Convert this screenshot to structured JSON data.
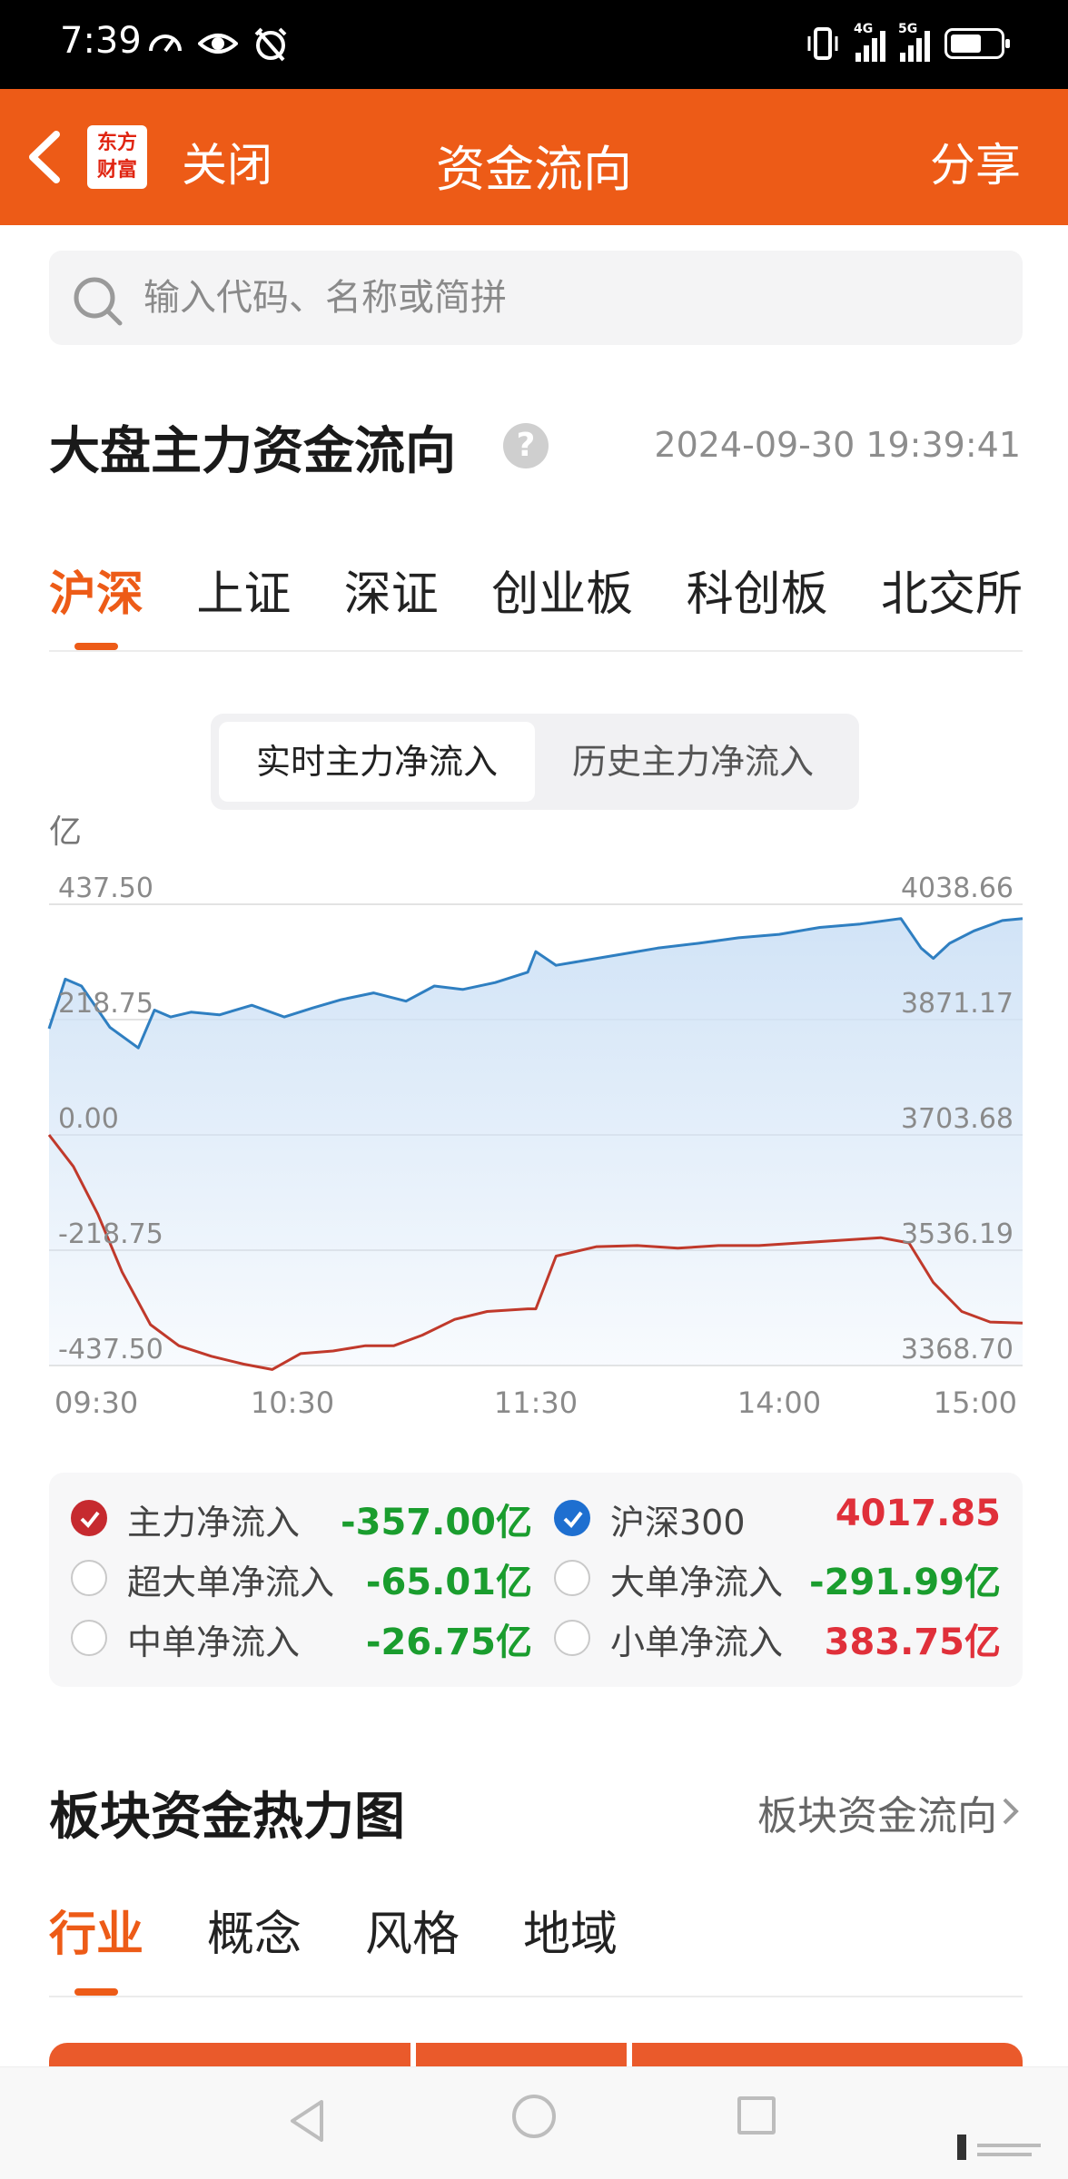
{
  "status_bar": {
    "time": "7:39",
    "net_4g": "4G",
    "net_5g": "5G"
  },
  "nav": {
    "back_icon": "chevron-left-icon",
    "logo_line1": "东方",
    "logo_line2": "财富",
    "close": "关闭",
    "title": "资金流向",
    "share": "分享"
  },
  "search": {
    "placeholder": "输入代码、名称或简拼",
    "value": ""
  },
  "section": {
    "title": "大盘主力资金流向",
    "help": "?",
    "timestamp": "2024-09-30 19:39:41"
  },
  "market_tabs": [
    {
      "label": "沪深",
      "active": true
    },
    {
      "label": "上证",
      "active": false
    },
    {
      "label": "深证",
      "active": false
    },
    {
      "label": "创业板",
      "active": false
    },
    {
      "label": "科创板",
      "active": false
    },
    {
      "label": "北交所",
      "active": false
    }
  ],
  "toggle": {
    "realtime": "实时主力净流入",
    "history": "历史主力净流入",
    "active": "realtime"
  },
  "chart_data": {
    "type": "line",
    "unit_label": "亿",
    "left_axis_ticks": [
      "437.50",
      "218.75",
      "0.00",
      "-218.75",
      "-437.50"
    ],
    "right_axis_ticks": [
      "4038.66",
      "3871.17",
      "3703.68",
      "3536.19",
      "3368.70"
    ],
    "x_ticks": [
      "09:30",
      "10:30",
      "11:30",
      "14:00",
      "15:00"
    ],
    "left_ylim": [
      -437.5,
      437.5
    ],
    "right_ylim": [
      3368.7,
      4038.66
    ],
    "grid": true,
    "colors": {
      "index": "#2f7fc1",
      "net_inflow": "#c0392b",
      "fill_top": "#cfe2f6"
    },
    "series": [
      {
        "name": "沪深300",
        "axis": "right",
        "color": "#2f7fc1",
        "x": [
          "09:30",
          "09:34",
          "09:38",
          "09:45",
          "09:52",
          "09:56",
          "10:00",
          "10:05",
          "10:12",
          "10:20",
          "10:28",
          "10:35",
          "10:42",
          "10:50",
          "10:58",
          "11:05",
          "11:12",
          "11:20",
          "11:28",
          "11:30",
          "13:05",
          "13:12",
          "13:20",
          "13:30",
          "13:40",
          "13:50",
          "14:00",
          "14:10",
          "14:20",
          "14:30",
          "14:35",
          "14:38",
          "14:42",
          "14:48",
          "14:55",
          "15:00"
        ],
        "values": [
          3858,
          3930,
          3920,
          3860,
          3830,
          3885,
          3875,
          3882,
          3878,
          3892,
          3875,
          3888,
          3900,
          3910,
          3898,
          3920,
          3915,
          3925,
          3940,
          3970,
          3950,
          3957,
          3965,
          3975,
          3982,
          3990,
          3995,
          4005,
          4010,
          4018,
          3975,
          3960,
          3982,
          4000,
          4015,
          4017.85
        ]
      },
      {
        "name": "主力净流入",
        "axis": "left",
        "color": "#c0392b",
        "x": [
          "09:30",
          "09:36",
          "09:42",
          "09:48",
          "09:55",
          "10:02",
          "10:10",
          "10:18",
          "10:25",
          "10:32",
          "10:40",
          "10:48",
          "10:55",
          "11:02",
          "11:10",
          "11:18",
          "11:28",
          "11:30",
          "13:05",
          "13:15",
          "13:25",
          "13:35",
          "13:45",
          "13:55",
          "14:05",
          "14:15",
          "14:25",
          "14:32",
          "14:38",
          "14:45",
          "14:52",
          "15:00"
        ],
        "values": [
          0,
          -60,
          -150,
          -260,
          -360,
          -400,
          -420,
          -435,
          -445,
          -415,
          -410,
          -400,
          -400,
          -380,
          -350,
          -335,
          -330,
          -330,
          -230,
          -212,
          -210,
          -215,
          -210,
          -210,
          -205,
          -200,
          -195,
          -205,
          -280,
          -335,
          -355,
          -357
        ]
      }
    ]
  },
  "legend": [
    {
      "label": "主力净流入",
      "value": "-357.00亿",
      "checked": "red",
      "sign": "neg"
    },
    {
      "label": "沪深300",
      "value": "4017.85",
      "checked": "blue",
      "sign": "pos"
    },
    {
      "label": "超大单净流入",
      "value": "-65.01亿",
      "checked": "",
      "sign": "neg"
    },
    {
      "label": "大单净流入",
      "value": "-291.99亿",
      "checked": "",
      "sign": "neg"
    },
    {
      "label": "中单净流入",
      "value": "-26.75亿",
      "checked": "",
      "sign": "neg"
    },
    {
      "label": "小单净流入",
      "value": "383.75亿",
      "checked": "",
      "sign": "pos"
    }
  ],
  "heatmap": {
    "title": "板块资金热力图",
    "link": "板块资金流向",
    "tabs": [
      {
        "label": "行业",
        "active": true
      },
      {
        "label": "概念",
        "active": false
      },
      {
        "label": "风格",
        "active": false
      },
      {
        "label": "地域",
        "active": false
      }
    ]
  },
  "accent": "#ed5b17"
}
